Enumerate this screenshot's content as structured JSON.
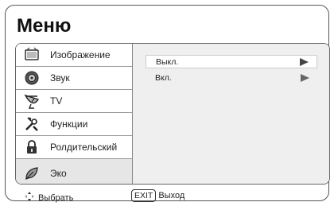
{
  "window": {
    "title": "Меню"
  },
  "menu": {
    "items": [
      {
        "label": "Изображение",
        "icon": "picture-icon"
      },
      {
        "label": "Звук",
        "icon": "speaker-icon"
      },
      {
        "label": "TV",
        "icon": "satellite-dish-icon"
      },
      {
        "label": "Функции",
        "icon": "tools-icon"
      },
      {
        "label": "Ролдительский",
        "icon": "lock-icon"
      },
      {
        "label": "Эко",
        "icon": "leaf-icon"
      }
    ],
    "selected": "Эко"
  },
  "options": [
    {
      "label": "Выкл.",
      "selected": true
    },
    {
      "label": "Вкл.",
      "selected": false
    }
  ],
  "footer": {
    "nav_label": "Выбрать",
    "exit_key": "EXIT",
    "exit_label": "Выход"
  }
}
